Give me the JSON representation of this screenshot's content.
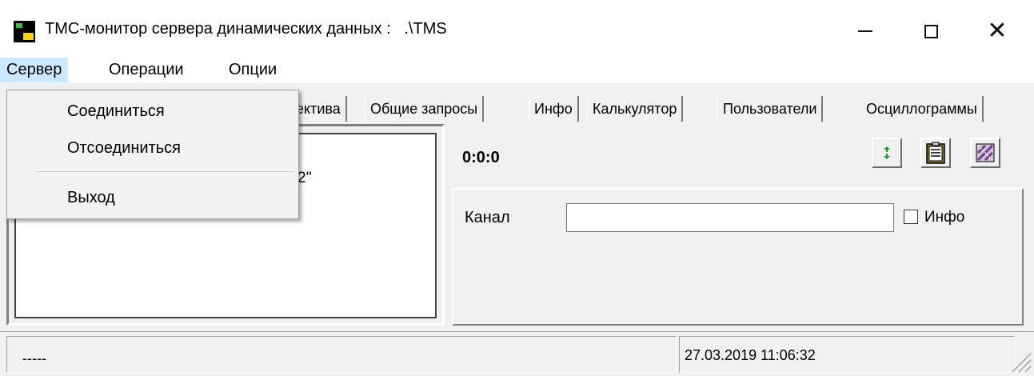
{
  "window": {
    "title": "ТМС-монитор сервера динамических данных :   .\\TMS",
    "controls": {
      "minimize": "minimize",
      "maximize": "maximize",
      "close": "✕"
    }
  },
  "menu": {
    "items": [
      "Сервер",
      "Операции",
      "Опции"
    ],
    "active": "Сервер"
  },
  "dropdown": {
    "items": [
      "Соединиться",
      "Отсоединиться",
      "Выход"
    ]
  },
  "tabs": [
    "ектива",
    "Общие запросы",
    "Инфо",
    "Калькулятор",
    "Пользователи",
    "Осциллограммы"
  ],
  "left_panel": {
    "text_fragment": "2''"
  },
  "right_panel": {
    "time": "0:0:0",
    "channel_label": "Канал",
    "channel_value": "",
    "info_checkbox_label": "Инфо",
    "info_checked": false,
    "toolbar_icons": [
      "refresh-icon",
      "clipboard-icon",
      "pattern-icon"
    ]
  },
  "status": {
    "left": "-----",
    "datetime": "27.03.2019 11:06:32"
  }
}
